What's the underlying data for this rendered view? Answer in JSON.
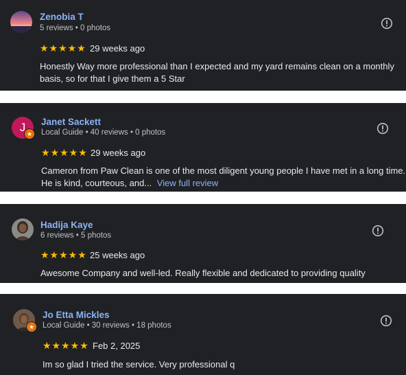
{
  "reviews": [
    {
      "name": "Zenobia T",
      "meta": "5 reviews • 0 photos",
      "rating": 5,
      "stars": "★★★★★",
      "date": "29 weeks ago",
      "text": "Honestly Way more professional than I expected and my yard remains clean on a monthly basis, so for that I give them a 5 Star",
      "avatar_type": "photo-sunset",
      "local_guide": false,
      "flag_icon": "report-icon"
    },
    {
      "name": "Janet Sackett",
      "meta": "Local Guide • 40 reviews • 0 photos",
      "rating": 5,
      "stars": "★★★★★",
      "date": "29 weeks ago",
      "text_line1": "Cameron from Paw Clean is one of the most diligent young people I have met in a long time.",
      "text_line2": "He is kind, courteous, and...",
      "more_link": "View full review",
      "avatar_letter": "J",
      "avatar_color": "#c2185b",
      "local_guide": true,
      "flag_icon": "report-icon"
    },
    {
      "name": "Hadija Kaye",
      "meta": "6 reviews • 5 photos",
      "rating": 5,
      "stars": "★★★★★",
      "date": "25 weeks ago",
      "text": "Awesome Company and well-led. Really flexible and dedicated to providing quality",
      "avatar_type": "photo-portrait",
      "local_guide": false,
      "flag_icon": "report-icon"
    },
    {
      "name": "Jo Etta Mickles",
      "meta": "Local Guide • 30 reviews • 18 photos",
      "rating": 5,
      "stars": "★★★★★",
      "date": "Feb 2, 2025",
      "text": "Im so glad I tried the service. Very professional q",
      "avatar_type": "photo-portrait",
      "local_guide": true,
      "flag_icon": "report-icon"
    }
  ],
  "colors": {
    "card_bg": "#202124",
    "name": "#8ab4f8",
    "star": "#fbbc04",
    "guide_badge": "#e8710a"
  }
}
